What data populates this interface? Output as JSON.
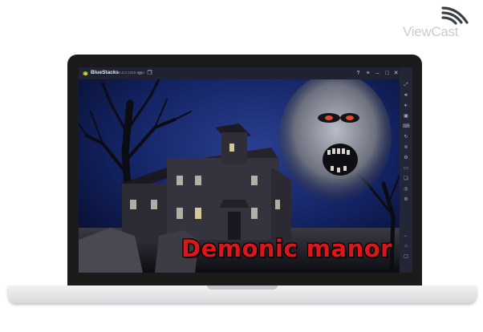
{
  "brand": {
    "name": "ViewCast"
  },
  "emulator": {
    "name": "BlueStacks",
    "version": "5.0.0.1026 Beta",
    "titlebar_icons": [
      "home-icon",
      "multi-instance-icon",
      "help-icon",
      "menu-icon",
      "minimize-icon",
      "maximize-icon",
      "close-icon",
      "collapse-sidebar-icon"
    ],
    "sidebar_icons": [
      "fullscreen-icon",
      "volume-up-icon",
      "volume-down-icon",
      "screen-record-icon",
      "keyboard-icon",
      "rotate-icon",
      "shake-icon",
      "macro-icon",
      "folder-icon",
      "multi-instance-manager-icon",
      "eco-mode-icon",
      "settings-icon",
      "back-icon",
      "home-icon",
      "recent-apps-icon"
    ]
  },
  "game": {
    "title": "Demonic manor"
  },
  "colors": {
    "title_red": "#e0151a",
    "sky": "#0e1a4a",
    "chrome": "#1e2232"
  }
}
